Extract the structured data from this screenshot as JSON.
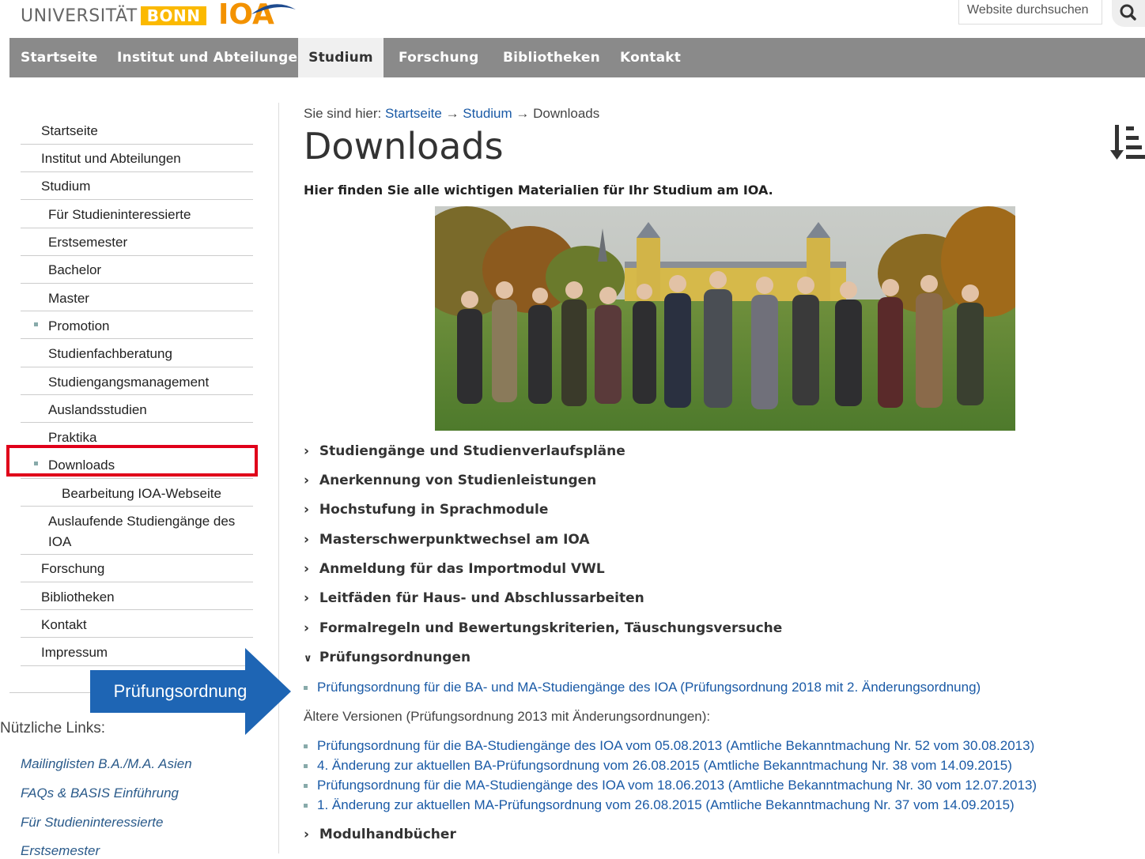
{
  "header": {
    "uni_text": "UNIVERSITÄT",
    "uni_bonn": "BONN",
    "ioa": "IOA",
    "search_placeholder": "Website durchsuchen"
  },
  "topnav": [
    "Startseite",
    "Institut und Abteilungen",
    "Studium",
    "Forschung",
    "Bibliotheken",
    "Kontakt"
  ],
  "sidebar": {
    "items": [
      "Startseite",
      "Institut und Abteilungen",
      "Studium",
      "Für Studieninteressierte",
      "Erstsemester",
      "Bachelor",
      "Master",
      "Promotion",
      "Studienfachberatung",
      "Studiengangsmanagement",
      "Auslandsstudien",
      "Praktika",
      "Downloads",
      "Bearbeitung IOA-Webseite",
      "Auslaufende Studiengänge des",
      "IOA",
      "Forschung",
      "Bibliotheken",
      "Kontakt",
      "Impressum"
    ],
    "callout": "Prüfungsordnung",
    "useful_title": "Nützliche Links:",
    "useful_links": [
      "Mailinglisten B.A./M.A. Asien",
      "FAQs & BASIS Einführung",
      "Für Studieninteressierte",
      "Erstsemester"
    ]
  },
  "breadcrumb": {
    "prefix": "Sie sind hier:",
    "home": "Startseite",
    "sep": "→",
    "studium": "Studium",
    "current": "Downloads"
  },
  "page_title": "Downloads",
  "intro": "Hier finden Sie alle wichtigen Materialien für Ihr Studium am IOA.",
  "accordions": [
    "Studiengänge und Studienverlaufspläne",
    "Anerkennung von Studienleistungen",
    "Hochstufung in Sprachmodule",
    "Masterschwerpunktwechsel am IOA",
    "Anmeldung für das Importmodul VWL",
    "Leitfäden für Haus- und Abschlussarbeiten",
    "Formalregeln und Bewertungskriterien, Täuschungsversuche",
    "Prüfungsordnungen",
    "Modulhandbücher"
  ],
  "current_doc": "Prüfungsordnung für die BA- und MA-Studiengänge des IOA (Prüfungsordnung 2018 mit 2. Änderungsordnung)",
  "older_versions": "Ältere Versionen (Prüfungsordnung 2013 mit Änderungsordnungen):",
  "older_docs": [
    "Prüfungsordnung für die BA-Studiengänge des IOA vom 05.08.2013 (Amtliche Bekanntmachung Nr. 52 vom 30.08.2013)",
    "4. Änderung zur aktuellen BA-Prüfungsordnung vom 26.08.2015 (Amtliche Bekanntmachung Nr. 38 vom 14.09.2015)",
    "Prüfungsordnung für die MA-Studiengänge des IOA vom 18.06.2013 (Amtliche Bekanntmachung Nr. 30 vom 12.07.2013)",
    "1. Änderung zur aktuellen MA-Prüfungsordnung vom 26.08.2015 (Amtliche Bekanntmachung Nr. 37 vom 14.09.2015)"
  ],
  "colors": {
    "nav_bg": "#8a8a8a",
    "link": "#1a5aa6",
    "highlight": "#e0001a",
    "callout": "#1e65b4"
  }
}
